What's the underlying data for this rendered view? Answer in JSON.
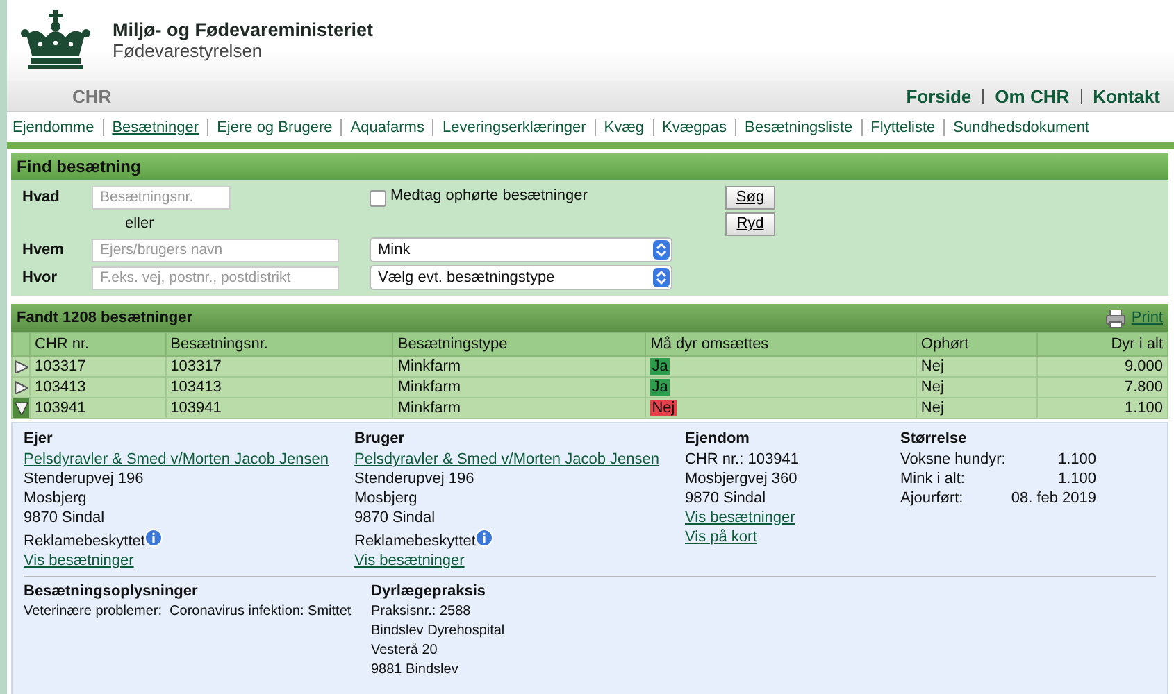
{
  "header": {
    "ministry": "Miljø- og Fødevareministeriet",
    "agency": "Fødevarestyrelsen"
  },
  "top_bar": {
    "title": "CHR",
    "links": [
      "Forside",
      "Om CHR",
      "Kontakt"
    ]
  },
  "nav": [
    {
      "label": "Ejendomme",
      "selected": false
    },
    {
      "label": "Besætninger",
      "selected": true
    },
    {
      "label": "Ejere og Brugere",
      "selected": false
    },
    {
      "label": "Aquafarms",
      "selected": false
    },
    {
      "label": "Leveringserklæringer",
      "selected": false
    },
    {
      "label": "Kvæg",
      "selected": false
    },
    {
      "label": "Kvægpas",
      "selected": false
    },
    {
      "label": "Besætningsliste",
      "selected": false
    },
    {
      "label": "Flytteliste",
      "selected": false
    },
    {
      "label": "Sundhedsdokument",
      "selected": false
    }
  ],
  "search": {
    "title": "Find besætning",
    "hvad": {
      "label": "Hvad",
      "placeholder": "Besætningsnr."
    },
    "or": "eller",
    "hvem": {
      "label": "Hvem",
      "placeholder": "Ejers/brugers navn"
    },
    "hvor": {
      "label": "Hvor",
      "placeholder": "F.eks. vej, postnr., postdistrikt"
    },
    "include_ceased": {
      "label": "Medtag ophørte besætninger",
      "checked": false
    },
    "species_select": {
      "value": "Mink"
    },
    "type_select": {
      "value": "Vælg evt. besætningstype"
    },
    "buttons": [
      "Søg",
      "Ryd"
    ]
  },
  "results": {
    "title": "Fandt 1208 besætninger",
    "print": "Print",
    "columns": [
      "CHR nr.",
      "Besætningsnr.",
      "Besætningstype",
      "Må dyr omsættes",
      "Ophørt",
      "Dyr i alt"
    ],
    "rows": [
      {
        "chr": "103317",
        "herd_no": "103317",
        "type": "Minkfarm",
        "tradeable": "Ja",
        "color": "#2e9e4e",
        "ceased": "Nej",
        "animals": "9.000",
        "expanded": false
      },
      {
        "chr": "103413",
        "herd_no": "103413",
        "type": "Minkfarm",
        "tradeable": "Ja",
        "color": "#2e9e4e",
        "ceased": "Nej",
        "animals": "7.800",
        "expanded": false
      },
      {
        "chr": "103941",
        "herd_no": "103941",
        "type": "Minkfarm",
        "tradeable": "Nej",
        "color": "#e8404a",
        "ceased": "Nej",
        "animals": "1.100",
        "expanded": true
      }
    ]
  },
  "details": {
    "parties": [
      {
        "heading": "Ejer",
        "name": "Pelsdyravler & Smed v/Morten Jacob Jensen",
        "lines": [
          "Stenderupvej 196",
          "Mosbjerg",
          "9870 Sindal"
        ],
        "protected": "Reklamebeskyttet",
        "link": "Vis besætninger"
      },
      {
        "heading": "Bruger",
        "name": "Pelsdyravler & Smed v/Morten Jacob Jensen",
        "lines": [
          "Stenderupvej 196",
          "Mosbjerg",
          "9870 Sindal"
        ],
        "protected": "Reklamebeskyttet",
        "link": "Vis besætninger"
      }
    ],
    "property": {
      "heading": "Ejendom",
      "lines": [
        "CHR nr.: 103941",
        "Mosbjergvej 360",
        "9870 Sindal"
      ],
      "links": [
        "Vis besætninger",
        "Vis på kort"
      ]
    },
    "size": {
      "heading": "Størrelse",
      "rows": [
        {
          "label": "Voksne hundyr:",
          "value": "1.100"
        },
        {
          "label": "Mink i alt:",
          "value": "1.100"
        },
        {
          "label": "Ajourført:",
          "value": "08. feb 2019"
        }
      ]
    },
    "herd_info": {
      "heading": "Besætningsoplysninger",
      "text": "Veterinære problemer:  Coronavirus infektion: Smittet"
    },
    "vet": {
      "heading": "Dyrlægepraksis",
      "lines": [
        "Praksisnr.: 2588",
        "Bindslev Dyrehospital",
        "Vesterå 20",
        "9881 Bindslev"
      ]
    }
  }
}
